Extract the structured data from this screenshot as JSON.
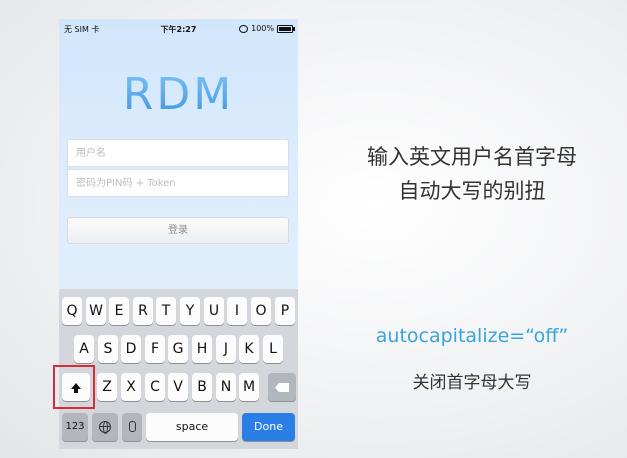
{
  "status_bar": {
    "carrier": "无 SIM 卡",
    "time": "下午2:27",
    "battery": "100%"
  },
  "app": {
    "logo": "RDM",
    "username_placeholder": "用户名",
    "password_placeholder": "密码为PIN码 + Token",
    "login_label": "登录"
  },
  "keyboard": {
    "row1": [
      "Q",
      "W",
      "E",
      "R",
      "T",
      "Y",
      "U",
      "I",
      "O",
      "P"
    ],
    "row2": [
      "A",
      "S",
      "D",
      "F",
      "G",
      "H",
      "J",
      "K",
      "L"
    ],
    "row3": [
      "Z",
      "X",
      "C",
      "V",
      "B",
      "N",
      "M"
    ],
    "numbers_label": "123",
    "space_label": "space",
    "done_label": "Done",
    "shift_state": "on"
  },
  "notes": {
    "line1": "输入英文用户名首字母",
    "line2": "自动大写的别扭",
    "code": "autocapitalize=“off”",
    "caption": "关闭首字母大写"
  },
  "colors": {
    "accent": "#3aa3dc",
    "done_key": "#2a7ee6",
    "highlight": "#d42d3b"
  }
}
